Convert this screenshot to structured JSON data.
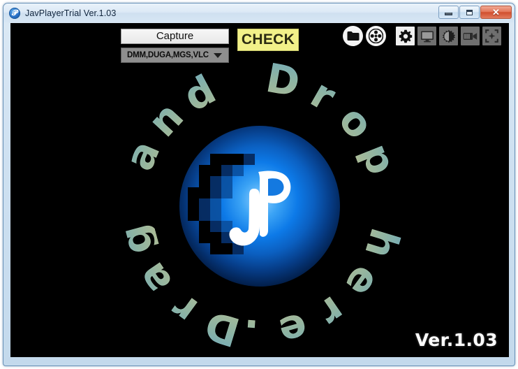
{
  "window": {
    "title": "JavPlayerTrial Ver.1.03",
    "app_icon": "jp-app-icon",
    "controls": {
      "minimize_label": "",
      "maximize_label": "",
      "close_label": "✕"
    }
  },
  "toolbar": {
    "capture_label": "Capture",
    "dropdown_value": "DMM,DUGA,MGS,VLC",
    "check_label": "CHECK",
    "icons": [
      {
        "name": "folder-icon",
        "style": "round"
      },
      {
        "name": "film-reel-icon",
        "style": "round"
      },
      {
        "name": "gear-icon",
        "style": "light"
      },
      {
        "name": "monitor-icon",
        "style": "dark"
      },
      {
        "name": "brightness-icon",
        "style": "dark"
      },
      {
        "name": "video-camera-icon",
        "style": "dark"
      },
      {
        "name": "enhance-icon",
        "style": "dark"
      }
    ]
  },
  "drop_zone": {
    "circular_text": "Drag and Drop here.",
    "logo_text": "JP"
  },
  "footer": {
    "version": "Ver.1.03"
  },
  "colors": {
    "check_button": "#f2f189",
    "logo_blue": "#0d7ae8",
    "drop_text": "#bdf0da",
    "content_background": "#000000",
    "titlebar": "#dce9f6"
  }
}
